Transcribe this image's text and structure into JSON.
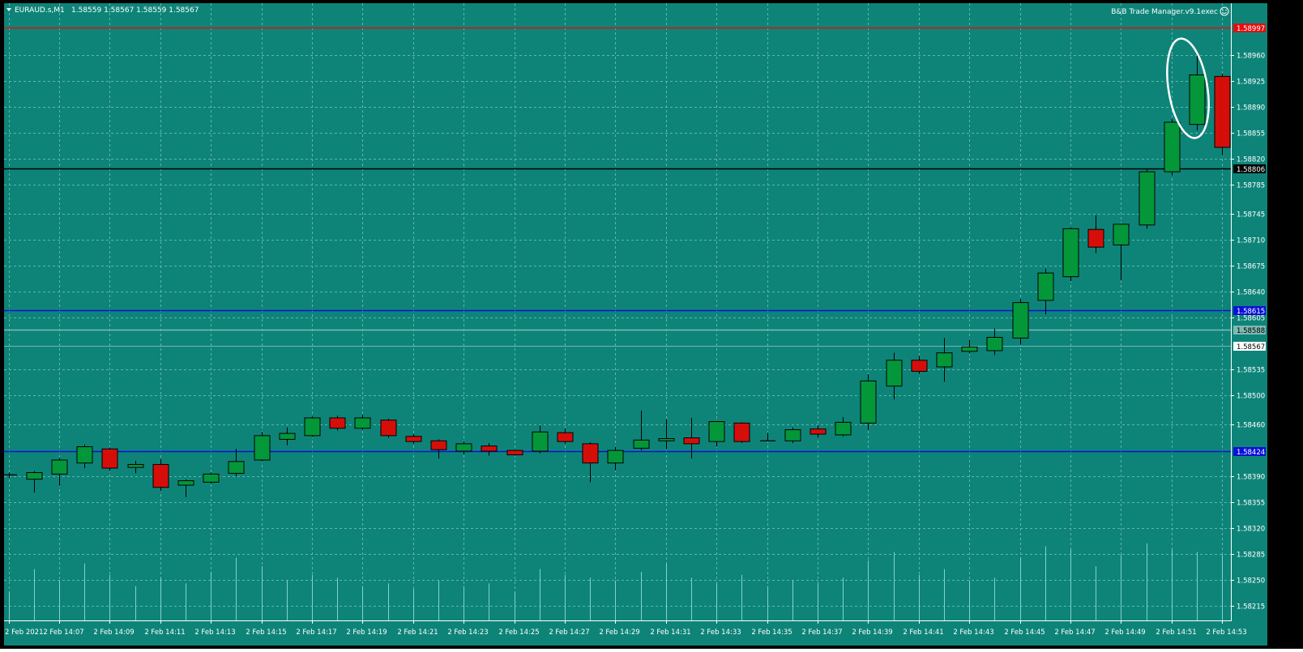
{
  "header": {
    "symbol": "EURAUD.s,M1",
    "ohlc": "1.58559 1.58567 1.58559 1.58567",
    "ea_label": "B&B Trade Manager.v9.1exec",
    "ea_icon": "smiley-icon",
    "menu_icon": "triangle-down-icon"
  },
  "colors": {
    "background": "#0e8479",
    "grid": "#5fb5aa",
    "bull": "#03973a",
    "bear": "#d60e0a",
    "wick": "#000000",
    "volume": "#7fd3c8"
  },
  "chart_data": {
    "type": "candlestick",
    "y_ticks": [
      "1.58960",
      "1.58925",
      "1.58890",
      "1.58855",
      "1.58820",
      "1.58785",
      "1.58745",
      "1.58710",
      "1.58675",
      "1.58640",
      "1.58605",
      "1.58535",
      "1.58500",
      "1.58460",
      "1.58390",
      "1.58355",
      "1.58320",
      "1.58285",
      "1.58250",
      "1.58215"
    ],
    "x_labels": [
      "2 Feb 2021",
      "2 Feb 14:07",
      "2 Feb 14:09",
      "2 Feb 14:11",
      "2 Feb 14:13",
      "2 Feb 14:15",
      "2 Feb 14:17",
      "2 Feb 14:19",
      "2 Feb 14:21",
      "2 Feb 14:23",
      "2 Feb 14:25",
      "2 Feb 14:27",
      "2 Feb 14:29",
      "2 Feb 14:31",
      "2 Feb 14:33",
      "2 Feb 14:35",
      "2 Feb 14:37",
      "2 Feb 14:39",
      "2 Feb 14:41",
      "2 Feb 14:43",
      "2 Feb 14:45",
      "2 Feb 14:47",
      "2 Feb 14:49",
      "2 Feb 14:51",
      "2 Feb 14:53"
    ],
    "price_range": [
      1.58195,
      1.5903
    ],
    "levels": [
      {
        "price": 1.58997,
        "label": "1.58997",
        "color": "#e01010"
      },
      {
        "price": 1.58806,
        "label": "1.58806",
        "color": "#000000"
      },
      {
        "price": 1.58615,
        "label": "1.58615",
        "color": "#0a10d8"
      },
      {
        "price": 1.58588,
        "label": "1.58588",
        "color": "#7fb9b2"
      },
      {
        "price": 1.58567,
        "label": "1.58567",
        "color": "#ffffff"
      },
      {
        "price": 1.58424,
        "label": "1.58424",
        "color": "#0a10d8"
      }
    ],
    "candles": [
      {
        "o": 1.58392,
        "h": 1.58395,
        "l": 1.58388,
        "c": 1.58392
      },
      {
        "o": 1.58386,
        "h": 1.58397,
        "l": 1.58368,
        "c": 1.58395
      },
      {
        "o": 1.58393,
        "h": 1.58415,
        "l": 1.58377,
        "c": 1.58412
      },
      {
        "o": 1.58408,
        "h": 1.58433,
        "l": 1.58401,
        "c": 1.5843
      },
      {
        "o": 1.58427,
        "h": 1.58429,
        "l": 1.58397,
        "c": 1.58401
      },
      {
        "o": 1.58402,
        "h": 1.58411,
        "l": 1.58394,
        "c": 1.58406
      },
      {
        "o": 1.58406,
        "h": 1.58413,
        "l": 1.5837,
        "c": 1.58375
      },
      {
        "o": 1.58378,
        "h": 1.58386,
        "l": 1.58362,
        "c": 1.58384
      },
      {
        "o": 1.58382,
        "h": 1.58395,
        "l": 1.5838,
        "c": 1.58393
      },
      {
        "o": 1.58394,
        "h": 1.58427,
        "l": 1.5839,
        "c": 1.5841
      },
      {
        "o": 1.58412,
        "h": 1.5845,
        "l": 1.5841,
        "c": 1.58445
      },
      {
        "o": 1.5844,
        "h": 1.58456,
        "l": 1.58432,
        "c": 1.58448
      },
      {
        "o": 1.58445,
        "h": 1.58471,
        "l": 1.58443,
        "c": 1.58469
      },
      {
        "o": 1.58469,
        "h": 1.58472,
        "l": 1.58452,
        "c": 1.58455
      },
      {
        "o": 1.58455,
        "h": 1.58473,
        "l": 1.58453,
        "c": 1.58469
      },
      {
        "o": 1.58466,
        "h": 1.58468,
        "l": 1.58442,
        "c": 1.58445
      },
      {
        "o": 1.58444,
        "h": 1.58447,
        "l": 1.58434,
        "c": 1.58437
      },
      {
        "o": 1.58438,
        "h": 1.5844,
        "l": 1.58414,
        "c": 1.58426
      },
      {
        "o": 1.58424,
        "h": 1.58437,
        "l": 1.5842,
        "c": 1.58434
      },
      {
        "o": 1.58431,
        "h": 1.58435,
        "l": 1.58418,
        "c": 1.58424
      },
      {
        "o": 1.58425,
        "h": 1.58426,
        "l": 1.58418,
        "c": 1.58419
      },
      {
        "o": 1.58424,
        "h": 1.58459,
        "l": 1.58421,
        "c": 1.5845
      },
      {
        "o": 1.58449,
        "h": 1.58455,
        "l": 1.58434,
        "c": 1.58437
      },
      {
        "o": 1.58434,
        "h": 1.58436,
        "l": 1.58382,
        "c": 1.58408
      },
      {
        "o": 1.58408,
        "h": 1.5843,
        "l": 1.58398,
        "c": 1.58425
      },
      {
        "o": 1.58428,
        "h": 1.58479,
        "l": 1.58425,
        "c": 1.58439
      },
      {
        "o": 1.58438,
        "h": 1.58467,
        "l": 1.58427,
        "c": 1.58441
      },
      {
        "o": 1.58442,
        "h": 1.58469,
        "l": 1.58414,
        "c": 1.58434
      },
      {
        "o": 1.58437,
        "h": 1.58464,
        "l": 1.5843,
        "c": 1.58464
      },
      {
        "o": 1.58462,
        "h": 1.58463,
        "l": 1.58435,
        "c": 1.58437
      },
      {
        "o": 1.58438,
        "h": 1.58449,
        "l": 1.58437,
        "c": 1.58438
      },
      {
        "o": 1.58438,
        "h": 1.58456,
        "l": 1.58435,
        "c": 1.58453
      },
      {
        "o": 1.58454,
        "h": 1.58459,
        "l": 1.58442,
        "c": 1.58447
      },
      {
        "o": 1.58446,
        "h": 1.5847,
        "l": 1.58444,
        "c": 1.58463
      },
      {
        "o": 1.58462,
        "h": 1.58528,
        "l": 1.58453,
        "c": 1.58519
      },
      {
        "o": 1.58512,
        "h": 1.58557,
        "l": 1.58494,
        "c": 1.58547
      },
      {
        "o": 1.58547,
        "h": 1.58553,
        "l": 1.58528,
        "c": 1.58532
      },
      {
        "o": 1.58538,
        "h": 1.58577,
        "l": 1.58518,
        "c": 1.58557
      },
      {
        "o": 1.58559,
        "h": 1.58575,
        "l": 1.58556,
        "c": 1.58565
      },
      {
        "o": 1.5856,
        "h": 1.5859,
        "l": 1.58554,
        "c": 1.58578
      },
      {
        "o": 1.58577,
        "h": 1.5863,
        "l": 1.58568,
        "c": 1.58625
      },
      {
        "o": 1.58628,
        "h": 1.58671,
        "l": 1.58609,
        "c": 1.58665
      },
      {
        "o": 1.5866,
        "h": 1.58727,
        "l": 1.58654,
        "c": 1.58725
      },
      {
        "o": 1.58724,
        "h": 1.58743,
        "l": 1.58692,
        "c": 1.587
      },
      {
        "o": 1.58703,
        "h": 1.58732,
        "l": 1.58655,
        "c": 1.58731
      },
      {
        "o": 1.5873,
        "h": 1.58805,
        "l": 1.58725,
        "c": 1.58802
      },
      {
        "o": 1.58802,
        "h": 1.58873,
        "l": 1.58797,
        "c": 1.58869
      },
      {
        "o": 1.58866,
        "h": 1.58965,
        "l": 1.58858,
        "c": 1.58933
      },
      {
        "o": 1.58931,
        "h": 1.58935,
        "l": 1.58824,
        "c": 1.58835
      }
    ],
    "volume": [
      10,
      18,
      14,
      20,
      16,
      12,
      15,
      13,
      17,
      22,
      19,
      14,
      16,
      15,
      12,
      13,
      11,
      14,
      12,
      13,
      10,
      18,
      16,
      15,
      14,
      17,
      20,
      15,
      13,
      16,
      12,
      14,
      13,
      15,
      21,
      24,
      16,
      18,
      14,
      15,
      22,
      26,
      25,
      19,
      23,
      27,
      25,
      24,
      23
    ]
  }
}
